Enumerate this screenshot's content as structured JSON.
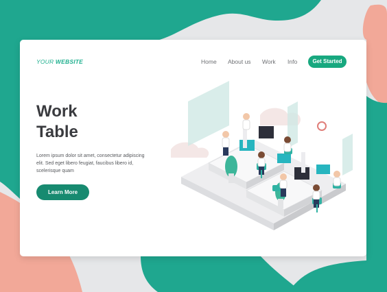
{
  "brand": {
    "part1": "YOUR ",
    "part2": "WEBSITE"
  },
  "nav": {
    "items": [
      "Home",
      "About us",
      "Work",
      "Info"
    ],
    "cta": "Get Started"
  },
  "hero": {
    "title_line1": "Work",
    "title_line2": "Table",
    "description": "Lorem ipsum dolor sit amet, consectetur adipiscing elit. Sed eget libero feugiat, faucibus libero id, scelerisque quam",
    "button": "Learn More"
  },
  "colors": {
    "teal": "#1fa78f",
    "coral": "#f2a898",
    "accent_green": "#18a87f",
    "title": "#3a3b3f"
  },
  "illustration": {
    "subject": "isometric office work tables with people at computers"
  }
}
